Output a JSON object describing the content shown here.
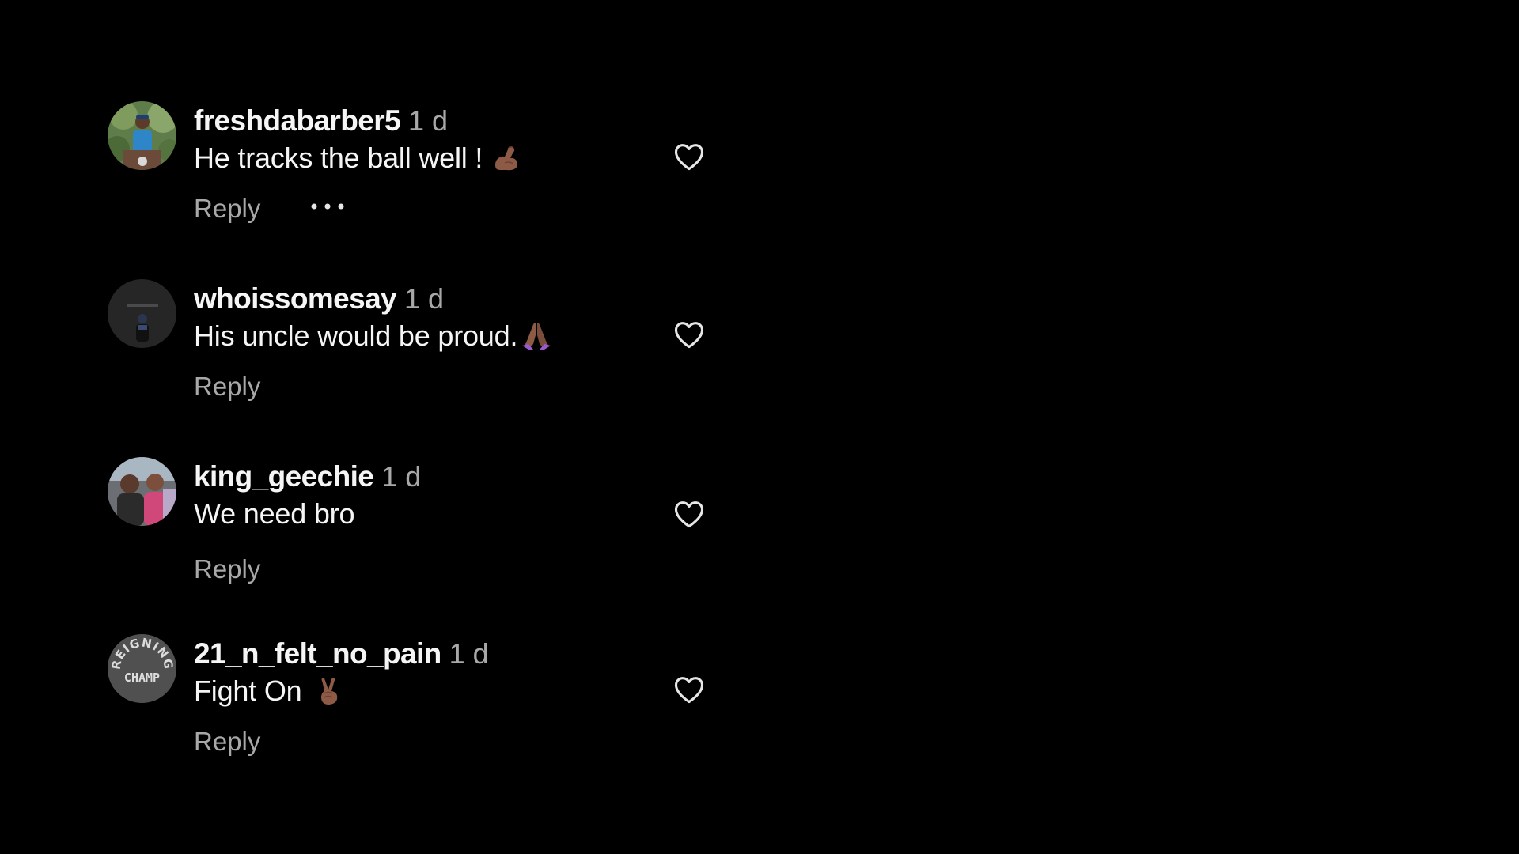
{
  "colors": {
    "background": "#000000",
    "username": "#f5f5f5",
    "secondary_text": "#a8a8a8",
    "icon": "#e6e6e6"
  },
  "comments": [
    {
      "username": "freshdabarber5",
      "time": "1 d",
      "text": "He tracks the ball well !",
      "emoji": "flexed-biceps-emoji",
      "reply_label": "Reply",
      "has_more_button": true,
      "avatar": "photo-avatar-outdoor"
    },
    {
      "username": "whoissomesay",
      "time": "1 d",
      "text": "His uncle would be proud.",
      "emoji": "folded-hands-emoji",
      "reply_label": "Reply",
      "has_more_button": false,
      "avatar": "photo-avatar-dark"
    },
    {
      "username": "king_geechie",
      "time": "1 d",
      "text": "We need bro",
      "emoji": "",
      "reply_label": "Reply",
      "has_more_button": false,
      "avatar": "photo-avatar-group"
    },
    {
      "username": "21_n_felt_no_pain",
      "time": "1 d",
      "text": "Fight On",
      "emoji": "victory-hand-emoji",
      "reply_label": "Reply",
      "has_more_button": false,
      "avatar": "logo-avatar",
      "avatar_logo_text": [
        "REIGNING",
        "CHAMP"
      ]
    }
  ]
}
